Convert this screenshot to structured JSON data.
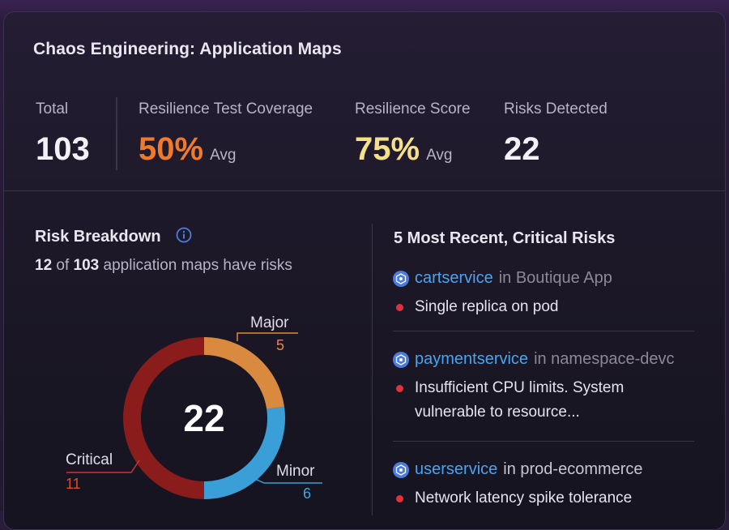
{
  "header": {
    "title": "Chaos Engineering: Application Maps"
  },
  "stats": [
    {
      "label": "Total",
      "value": "103",
      "suffix": "",
      "color": "#f3f1f7"
    },
    {
      "label": "Resilience Test Coverage",
      "value": "50%",
      "suffix": "Avg",
      "color": "#f07a2c"
    },
    {
      "label": "Resilience Score",
      "value": "75%",
      "suffix": "Avg",
      "color": "#f5e08a"
    },
    {
      "label": "Risks Detected",
      "value": "22",
      "suffix": "",
      "color": "#f3f1f7"
    }
  ],
  "risk_breakdown": {
    "title": "Risk Breakdown",
    "info_icon": "info-circle-icon",
    "subtitle_count": "12",
    "subtitle_mid": " of ",
    "subtitle_total": "103",
    "subtitle_tail": " application maps have risks",
    "total": "22",
    "segments": [
      {
        "label": "Critical",
        "count": 11,
        "color": "#8b1c1c",
        "count_color": "#e24a2b"
      },
      {
        "label": "Major",
        "count": 5,
        "color": "#d98a3f",
        "count_color": "#e8873a"
      },
      {
        "label": "Minor",
        "count": 6,
        "color": "#3a9fd6",
        "count_color": "#3aa8e6"
      }
    ]
  },
  "recent_risks": {
    "title": "5 Most Recent, Critical Risks",
    "items": [
      {
        "service": "cartservice",
        "context": "in Boutique App",
        "risk": "Single replica on pod",
        "icon": "kubernetes-icon"
      },
      {
        "service": "paymentservice",
        "context": "in namespace-devc",
        "risk": "Insufficient CPU limits. System vulnerable to resource...",
        "icon": "kubernetes-icon"
      },
      {
        "service": "userservice",
        "context": "in prod-ecommerce",
        "risk": "Network latency spike tolerance",
        "icon": "kubernetes-icon"
      }
    ]
  }
}
